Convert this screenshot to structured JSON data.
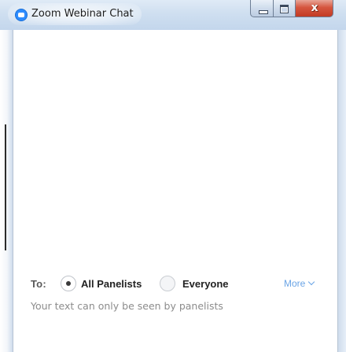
{
  "window": {
    "title": "Zoom Webinar Chat",
    "close_glyph": "x"
  },
  "icons": {
    "app": "zoom-icon",
    "minimize": "minimize-icon",
    "maximize": "maximize-icon",
    "close": "close-icon",
    "more_chevron": "chevron-down-icon"
  },
  "recipient": {
    "to_label": "To:",
    "options": [
      {
        "label": "All Panelists",
        "selected": true
      },
      {
        "label": "Everyone",
        "selected": false
      }
    ],
    "more_label": "More"
  },
  "input": {
    "value": "",
    "placeholder": "Your text can only be seen by panelists"
  },
  "colors": {
    "accent_link": "#6aa4e6",
    "titlebar": "#cfdff0",
    "close_button": "#d5563f",
    "zoom_blue": "#2d8cff"
  }
}
